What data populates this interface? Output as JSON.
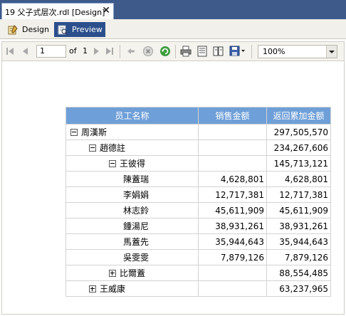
{
  "document_tab": {
    "title": "19 父子式层次.rdl [Design]",
    "close_glyph": "✕"
  },
  "subtabs": {
    "design": "Design",
    "preview": "Preview"
  },
  "toolbar": {
    "page_current": "1",
    "of_label": "of",
    "page_total": "1",
    "zoom": "100%"
  },
  "report": {
    "headers": [
      "员工名称",
      "销售金额",
      "返回累加金额"
    ],
    "rows": [
      {
        "name": "周漢斯",
        "toggle": "minus",
        "sales": "",
        "cumulative": "297,505,570"
      },
      {
        "name": "趙德註",
        "toggle": "minus",
        "sales": "",
        "cumulative": "234,267,606"
      },
      {
        "name": "王彼得",
        "toggle": "minus",
        "sales": "",
        "cumulative": "145,713,121"
      },
      {
        "name": "陳蓋瑞",
        "toggle": "none",
        "sales": "4,628,801",
        "cumulative": "4,628,801"
      },
      {
        "name": "李娟娟",
        "toggle": "none",
        "sales": "12,717,381",
        "cumulative": "12,717,381"
      },
      {
        "name": "林志鈴",
        "toggle": "none",
        "sales": "45,611,909",
        "cumulative": "45,611,909"
      },
      {
        "name": "鍾湯尼",
        "toggle": "none",
        "sales": "38,931,261",
        "cumulative": "38,931,261"
      },
      {
        "name": "馬蓋先",
        "toggle": "none",
        "sales": "35,944,643",
        "cumulative": "35,944,643"
      },
      {
        "name": "吳雯雯",
        "toggle": "none",
        "sales": "7,879,126",
        "cumulative": "7,879,126"
      },
      {
        "name": "比爾蓋",
        "toggle": "plus",
        "sales": "",
        "cumulative": "88,554,485"
      },
      {
        "name": "王威康",
        "toggle": "plus",
        "sales": "",
        "cumulative": "63,237,965"
      }
    ]
  },
  "colors": {
    "tab_bar": "#3d5a8a",
    "preview_tab": "#2b4f8c",
    "header_fill": "#6f9fd8"
  },
  "icons": [
    "design-icon",
    "preview-icon",
    "first-page-icon",
    "previous-page-icon",
    "next-page-icon",
    "last-page-icon",
    "back-icon",
    "stop-icon",
    "refresh-icon",
    "print-icon",
    "print-layout-icon",
    "page-setup-icon",
    "export-icon"
  ]
}
